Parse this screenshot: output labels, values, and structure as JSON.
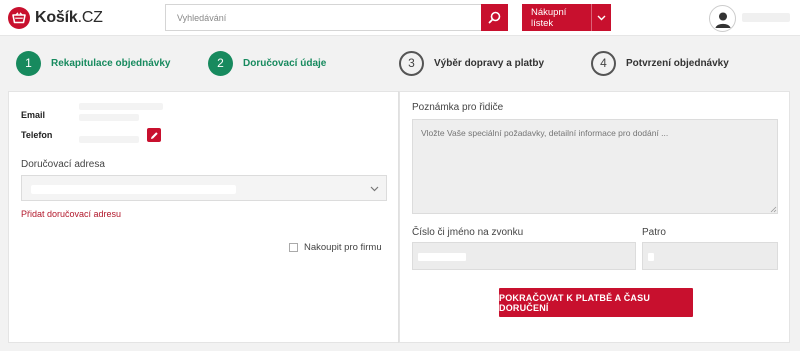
{
  "header": {
    "logo_name": "Košík",
    "logo_tld": ".CZ",
    "search_placeholder": "Vyhledávání",
    "shopping_list_label": "Nákupní lístek"
  },
  "steps": [
    {
      "number": "1",
      "label": "Rekapitulace objednávky",
      "state": "done"
    },
    {
      "number": "2",
      "label": "Doručovací údaje",
      "state": "active"
    },
    {
      "number": "3",
      "label": "Výběr dopravy a platby",
      "state": "todo"
    },
    {
      "number": "4",
      "label": "Potvrzení objednávky",
      "state": "todo"
    }
  ],
  "left": {
    "email_label": "Email",
    "phone_label": "Telefon",
    "address_label": "Doručovací adresa",
    "add_address_link": "Přidat doručovací adresu",
    "company_checkbox_label": "Nakoupit pro firmu",
    "company_checked": false
  },
  "right": {
    "driver_note_label": "Poznámka pro řidiče",
    "driver_note_placeholder": "Vložte Vaše speciální požadavky, detailní informace pro dodání ...",
    "doorbell_label": "Číslo či jméno na zvonku",
    "floor_label": "Patro",
    "continue_button": "POKRAČOVAT K PLATBĚ A ČASU DORUČENÍ"
  },
  "colors": {
    "brand_red": "#c8102e",
    "step_green": "#178a5e"
  },
  "icons": {
    "logo": "shopping-basket-icon",
    "search": "search-icon",
    "dropdown": "chevron-down-icon",
    "avatar": "user-avatar-icon",
    "edit": "pencil-icon"
  }
}
